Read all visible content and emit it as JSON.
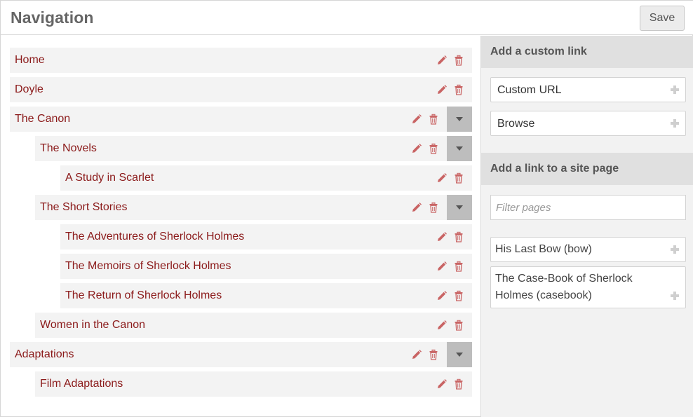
{
  "header": {
    "title": "Navigation",
    "save_label": "Save"
  },
  "nav_items": [
    {
      "label": "Home",
      "depth": 0,
      "has_children": false
    },
    {
      "label": "Doyle",
      "depth": 0,
      "has_children": false
    },
    {
      "label": "The Canon",
      "depth": 0,
      "has_children": true
    },
    {
      "label": "The Novels",
      "depth": 1,
      "has_children": true
    },
    {
      "label": "A Study in Scarlet",
      "depth": 2,
      "has_children": false
    },
    {
      "label": "The Short Stories",
      "depth": 1,
      "has_children": true
    },
    {
      "label": "The Adventures of Sherlock Holmes",
      "depth": 2,
      "has_children": false
    },
    {
      "label": "The Memoirs of Sherlock Holmes",
      "depth": 2,
      "has_children": false
    },
    {
      "label": "The Return of Sherlock Holmes",
      "depth": 2,
      "has_children": false
    },
    {
      "label": "Women in the Canon",
      "depth": 1,
      "has_children": false
    },
    {
      "label": "Adaptations",
      "depth": 0,
      "has_children": true
    },
    {
      "label": "Film Adaptations",
      "depth": 1,
      "has_children": false
    }
  ],
  "row_icons": {
    "edit": "pencil-icon",
    "delete": "trash-icon",
    "toggle": "caret-down-icon"
  },
  "custom_link": {
    "heading": "Add a custom link",
    "options": [
      {
        "label": "Custom URL",
        "icon": "plus-icon"
      },
      {
        "label": "Browse",
        "icon": "plus-icon"
      }
    ]
  },
  "site_page": {
    "heading": "Add a link to a site page",
    "filter_placeholder": "Filter pages",
    "filter_value": "",
    "pages": [
      {
        "label": "His Last Bow (bow)",
        "icon": "plus-icon"
      },
      {
        "label": "The Case-Book of Sherlock Holmes (casebook)",
        "icon": "plus-icon"
      }
    ]
  },
  "colors": {
    "link": "#8b1a1a",
    "icon": "#c96464",
    "row_bg": "#f3f3f3",
    "toggle_bg": "#bdbdbd",
    "panel_bg": "#f2f2f2",
    "panel_head_bg": "#e0e0e0"
  }
}
